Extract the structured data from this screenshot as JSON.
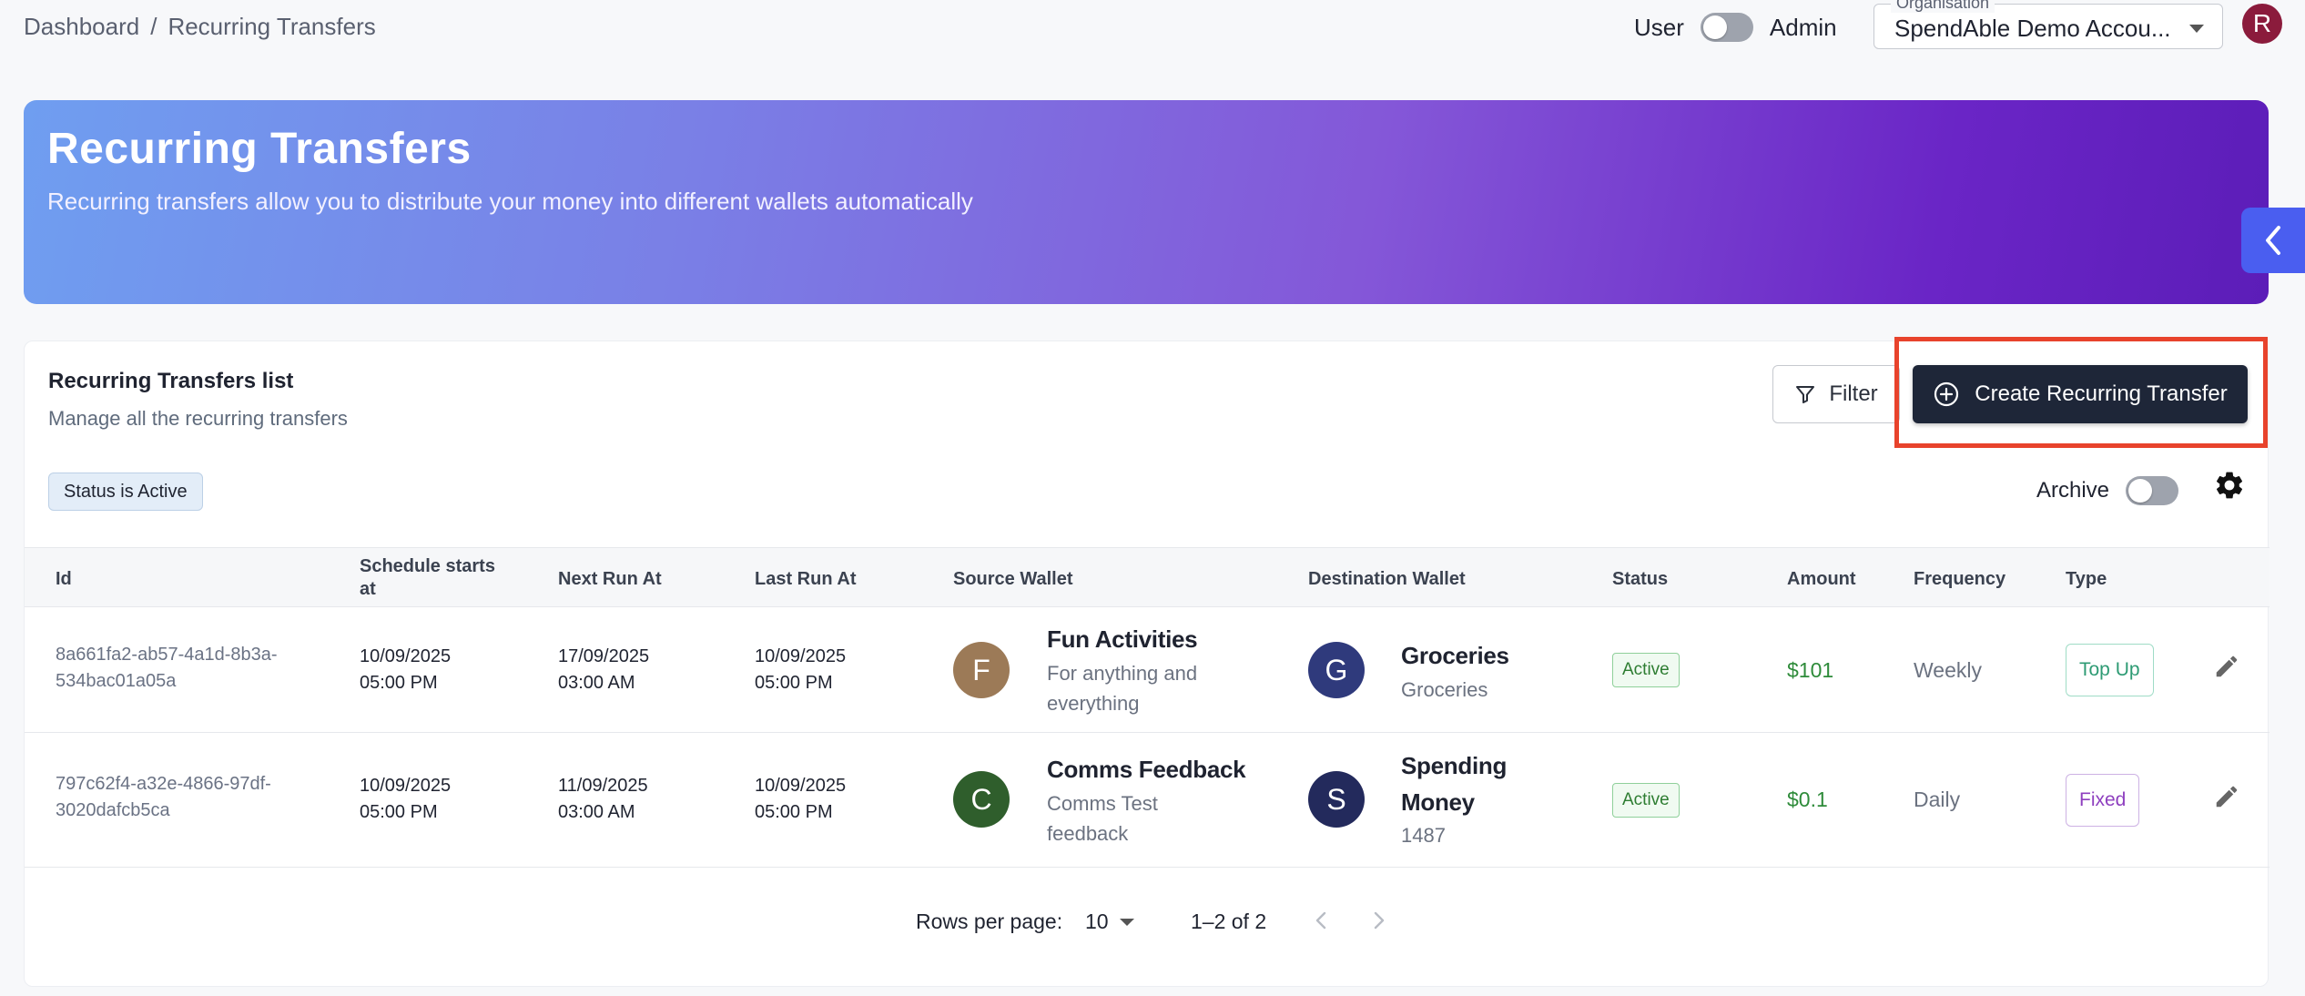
{
  "breadcrumb": {
    "root": "Dashboard",
    "separator": "/",
    "current": "Recurring Transfers"
  },
  "role_toggle": {
    "left_label": "User",
    "right_label": "Admin"
  },
  "organisation": {
    "label": "Organisation",
    "value": "SpendAble Demo Accou..."
  },
  "user_avatar": {
    "initial": "R",
    "color": "#8b1b3c"
  },
  "hero": {
    "title": "Recurring Transfers",
    "subtitle": "Recurring transfers allow you to distribute your money into different wallets automatically"
  },
  "card": {
    "title": "Recurring Transfers list",
    "subtitle": "Manage all the recurring transfers",
    "filter_label": "Filter",
    "create_label": "Create Recurring Transfer",
    "chip": "Status is Active",
    "archive_label": "Archive"
  },
  "columns": [
    "Id",
    "Schedule starts at",
    "Next Run At",
    "Last Run At",
    "Source Wallet",
    "Destination Wallet",
    "Status",
    "Amount",
    "Frequency",
    "Type"
  ],
  "rows": [
    {
      "id": "8a661fa2-ab57-4a1d-8b3a-534bac01a05a",
      "schedule_date": "10/09/2025",
      "schedule_time": "05:00 PM",
      "next_date": "17/09/2025",
      "next_time": "03:00 AM",
      "last_date": "10/09/2025",
      "last_time": "05:00 PM",
      "source": {
        "initial": "F",
        "name": "Fun Activities",
        "desc": "For anything and everything",
        "color": "#9c7a57"
      },
      "dest": {
        "initial": "G",
        "name": "Groceries",
        "desc": "Groceries",
        "color": "#2f3a7c"
      },
      "status": "Active",
      "amount": "$101",
      "frequency": "Weekly",
      "type": "Top Up"
    },
    {
      "id": "797c62f4-a32e-4866-97df-3020dafcb5ca",
      "schedule_date": "10/09/2025",
      "schedule_time": "05:00 PM",
      "next_date": "11/09/2025",
      "next_time": "03:00 AM",
      "last_date": "10/09/2025",
      "last_time": "05:00 PM",
      "source": {
        "initial": "C",
        "name": "Comms Feedback",
        "desc": "Comms Test feedback",
        "color": "#2f5e2c"
      },
      "dest": {
        "initial": "S",
        "name": "Spending Money",
        "desc": "1487",
        "color": "#232a5c"
      },
      "status": "Active",
      "amount": "$0.1",
      "frequency": "Daily",
      "type": "Fixed"
    }
  ],
  "pagination": {
    "rows_per_page_label": "Rows per page:",
    "rows_per_page": "10",
    "range": "1–2 of 2"
  },
  "colors": {
    "primary_button": "#1e2638",
    "highlight": "#e8432c",
    "accent_tab": "#4a5ef0",
    "active_green": "#2e7d32"
  }
}
